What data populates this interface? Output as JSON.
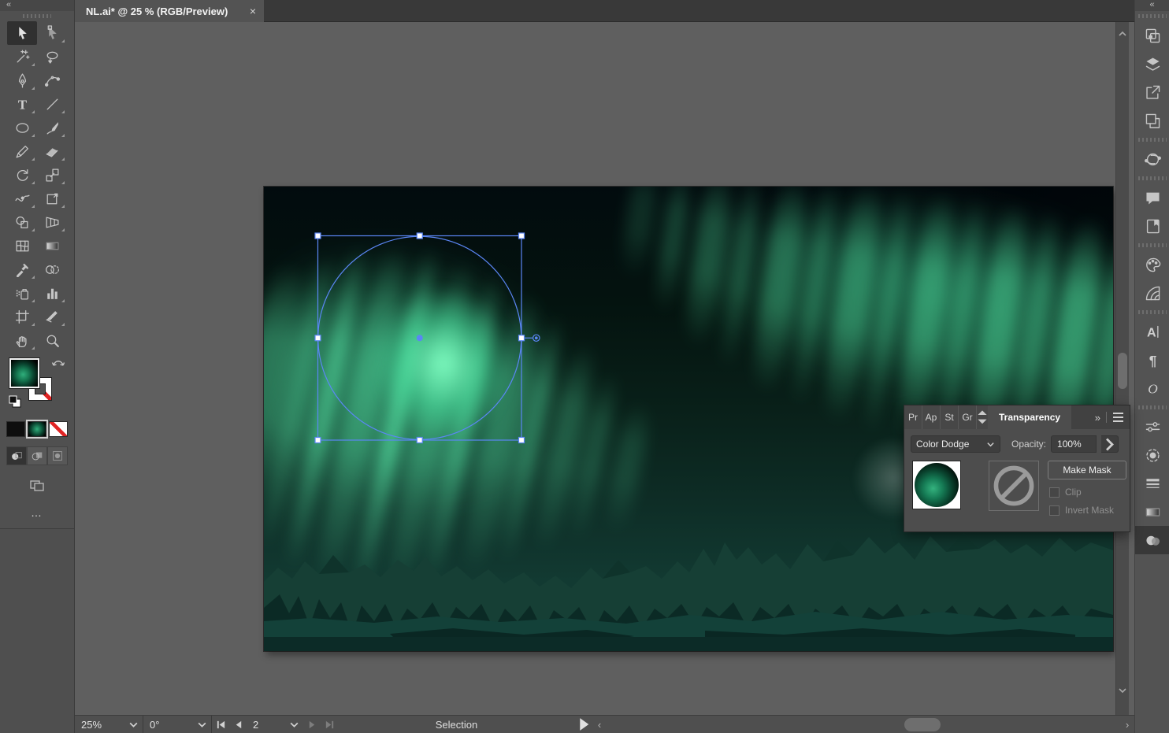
{
  "document_tab": {
    "title": "NL.ai* @ 25 % (RGB/Preview)",
    "close_label": "×"
  },
  "left_dock": {
    "collapse_label": "«",
    "edit_toolbar_label": "…",
    "tools": [
      {
        "name": "selection",
        "active": true,
        "flyout": false
      },
      {
        "name": "direct-selection",
        "active": false,
        "flyout": true
      },
      {
        "name": "magic-wand",
        "active": false,
        "flyout": true
      },
      {
        "name": "lasso",
        "active": false,
        "flyout": false
      },
      {
        "name": "pen",
        "active": false,
        "flyout": true
      },
      {
        "name": "curvature",
        "active": false,
        "flyout": false
      },
      {
        "name": "type",
        "active": false,
        "flyout": true
      },
      {
        "name": "line-segment",
        "active": false,
        "flyout": true
      },
      {
        "name": "ellipse",
        "active": false,
        "flyout": true
      },
      {
        "name": "paintbrush",
        "active": false,
        "flyout": true
      },
      {
        "name": "pencil",
        "active": false,
        "flyout": true
      },
      {
        "name": "eraser",
        "active": false,
        "flyout": true
      },
      {
        "name": "rotate",
        "active": false,
        "flyout": true
      },
      {
        "name": "scale",
        "active": false,
        "flyout": true
      },
      {
        "name": "width",
        "active": false,
        "flyout": true
      },
      {
        "name": "free-transform",
        "active": false,
        "flyout": true
      },
      {
        "name": "shape-builder",
        "active": false,
        "flyout": true
      },
      {
        "name": "perspective-grid",
        "active": false,
        "flyout": true
      },
      {
        "name": "mesh",
        "active": false,
        "flyout": false
      },
      {
        "name": "gradient",
        "active": false,
        "flyout": false
      },
      {
        "name": "eyedropper",
        "active": false,
        "flyout": true
      },
      {
        "name": "blend",
        "active": false,
        "flyout": false
      },
      {
        "name": "symbol-sprayer",
        "active": false,
        "flyout": true
      },
      {
        "name": "column-graph",
        "active": false,
        "flyout": true
      },
      {
        "name": "artboard",
        "active": false,
        "flyout": true
      },
      {
        "name": "slice",
        "active": false,
        "flyout": true
      },
      {
        "name": "hand",
        "active": false,
        "flyout": true
      },
      {
        "name": "zoom",
        "active": false,
        "flyout": false
      }
    ],
    "fill_type": "gradient",
    "stroke_type": "none",
    "appearance_buttons": [
      "color",
      "gradient",
      "none"
    ],
    "appearance_active": "gradient",
    "draw_modes": [
      "draw-normal",
      "draw-behind",
      "draw-inside"
    ],
    "draw_mode_active": "draw-normal"
  },
  "right_dock": {
    "collapse_label": "«",
    "groups": [
      [
        "properties",
        "layers",
        "export",
        "artboards"
      ],
      [
        "rotate-view"
      ],
      [
        "comments",
        "libraries"
      ],
      [
        "color",
        "color-guide"
      ],
      [
        "character",
        "paragraph",
        "opentype"
      ],
      [
        "sliders",
        "dashed-circle",
        "stroke",
        "gradient-panel",
        "transparency"
      ]
    ],
    "active_icon": "transparency"
  },
  "transparency_panel": {
    "truncated_tabs": [
      "Pr",
      "Ap",
      "St",
      "Gr"
    ],
    "active_tab": "Transparency",
    "expand_label": "»",
    "blend_mode": "Color Dodge",
    "opacity_label": "Opacity:",
    "opacity_value": "100%",
    "make_mask_label": "Make Mask",
    "clip_label": "Clip",
    "invert_mask_label": "Invert Mask"
  },
  "status_bar": {
    "zoom_value": "25%",
    "rotation_value": "0°",
    "artboard_value": "2",
    "status_label": "Selection",
    "left_chevron": "‹",
    "right_chevron": "›"
  },
  "colors": {
    "selection_blue": "#5b86f5",
    "aurora_bright": "#4fe3a0",
    "aurora_mid": "#2fa876",
    "sky_dark": "#041410",
    "ui_gray": "#535353"
  }
}
